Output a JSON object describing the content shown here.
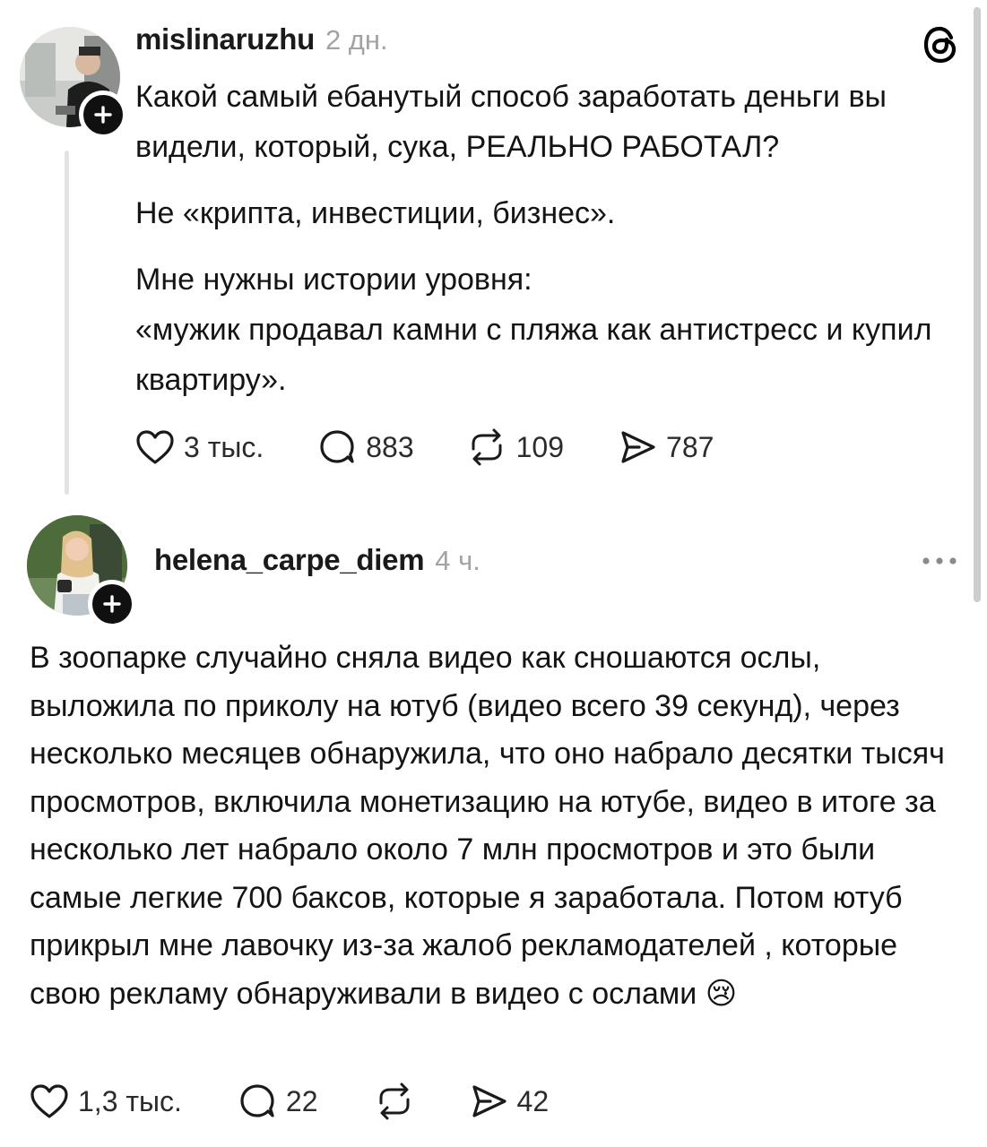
{
  "post": {
    "username": "mislinaruzhu",
    "time": "2 дн.",
    "paragraphs": [
      "Какой самый ебанутый способ заработать деньги вы видели, который, сука, РЕАЛЬНО РАБОТАЛ?",
      "Не «крипта, инвестиции, бизнес».",
      "Мне нужны истории уровня:",
      "«мужик продавал камни с пляжа как антистресс и купил квартиру»."
    ],
    "actions": {
      "likes": "3 тыс.",
      "comments": "883",
      "reposts": "109",
      "shares": "787"
    }
  },
  "reply": {
    "username": "helena_carpe_diem",
    "time": "4 ч.",
    "text": "В зоопарке случайно сняла видео как сношаются ослы, выложила по приколу на ютуб (видео всего 39 секунд), через несколько месяцев обнаружила, что оно набрало десятки тысяч просмотров, включила монетизацию на ютубе, видео в итоге за несколько лет набрало около 7 млн просмотров и это были самые легкие 700 баксов, которые я заработала. Потом ютуб прикрыл мне лавочку из-за жалоб рекламодателей , которые свою рекламу обнаруживали в видео с ослами",
    "emoji": "😢",
    "actions": {
      "likes": "1,3 тыс.",
      "comments": "22",
      "shares": "42"
    }
  },
  "icons": {
    "app": "threads-logo-icon",
    "more": "more-dots-icon",
    "like": "heart-icon",
    "comment": "comment-bubble-icon",
    "repost": "repost-icon",
    "share": "send-icon",
    "follow": "plus-icon"
  }
}
